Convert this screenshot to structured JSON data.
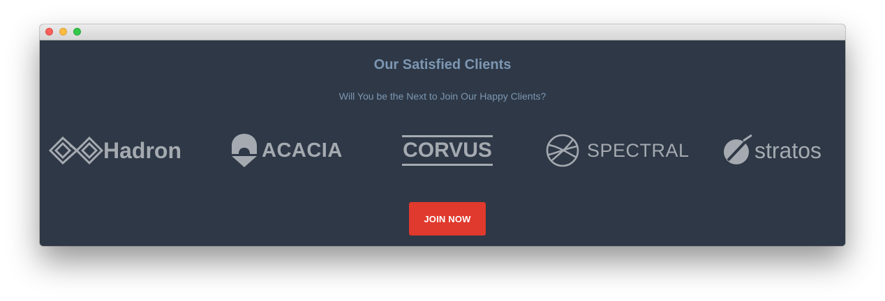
{
  "window": {
    "controls": [
      "close",
      "minimize",
      "maximize"
    ]
  },
  "section": {
    "title": "Our Satisfied Clients",
    "subtitle": "Will You be the Next to Join Our Happy Clients?"
  },
  "clients": [
    {
      "name": "Hadron",
      "icon": "hadron-logo-icon"
    },
    {
      "name": "ACACIA",
      "icon": "acacia-logo-icon"
    },
    {
      "name": "CORVUS",
      "icon": "corvus-logo-icon"
    },
    {
      "name": "SPECTRAL",
      "icon": "spectral-logo-icon"
    },
    {
      "name": "stratos",
      "icon": "stratos-logo-icon"
    }
  ],
  "cta": {
    "label": "JOIN NOW"
  },
  "colors": {
    "background": "#2e3846",
    "heading": "#7d97b3",
    "logo": "#a5aab1",
    "button": "#e0392d",
    "button_text": "#ffffff"
  }
}
